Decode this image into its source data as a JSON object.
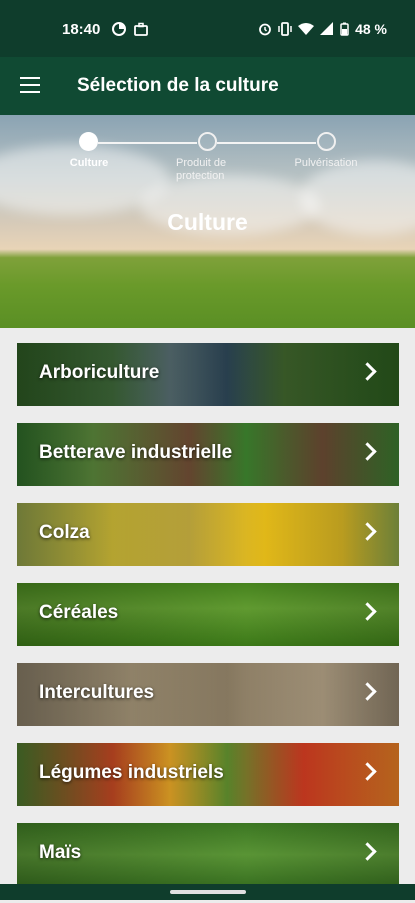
{
  "status_bar": {
    "time": "18:40",
    "battery": "48 %",
    "icons": [
      "data-saver-icon",
      "briefcase-icon",
      "alarm-icon",
      "vibrate-icon",
      "wifi-icon",
      "signal-icon",
      "battery-icon"
    ]
  },
  "app_bar": {
    "title": "Sélection de la culture",
    "menu_icon": "hamburger-menu-icon"
  },
  "stepper": {
    "steps": [
      {
        "label": "Culture",
        "state": "active"
      },
      {
        "label": "Produit de protection",
        "state": "inactive"
      },
      {
        "label": "Pulvérisation",
        "state": "inactive"
      }
    ]
  },
  "hero": {
    "title": "Culture"
  },
  "crops": [
    {
      "label": "Arboriculture"
    },
    {
      "label": "Betterave industrielle"
    },
    {
      "label": "Colza"
    },
    {
      "label": "Céréales"
    },
    {
      "label": "Intercultures"
    },
    {
      "label": "Légumes industriels"
    },
    {
      "label": "Maïs"
    }
  ],
  "colors": {
    "status_bar": "#0f3d2c",
    "app_bar": "#104a33",
    "background": "#ececec"
  }
}
